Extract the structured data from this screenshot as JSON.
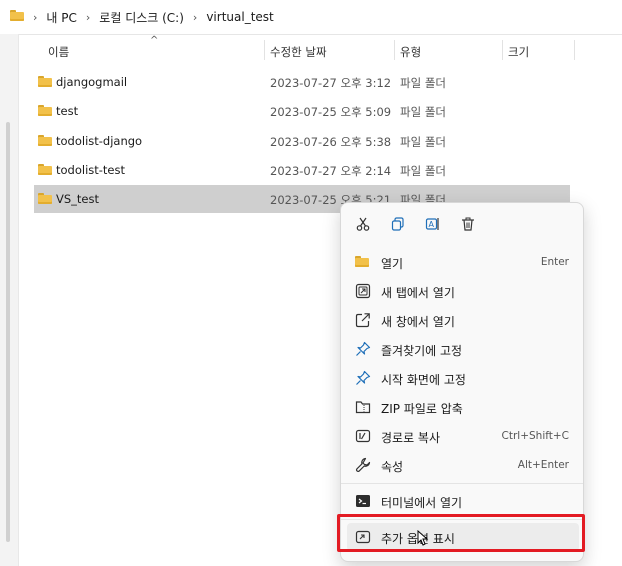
{
  "breadcrumb": [
    "내 PC",
    "로컬 디스크 (C:)",
    "virtual_test"
  ],
  "columns": {
    "name": "이름",
    "modified": "수정한 날짜",
    "type": "유형",
    "size": "크기"
  },
  "files": [
    {
      "name": "djangogmail",
      "date": "2023-07-27 오후 3:12",
      "type": "파일 폴더",
      "selected": false
    },
    {
      "name": "test",
      "date": "2023-07-25 오후 5:09",
      "type": "파일 폴더",
      "selected": false
    },
    {
      "name": "todolist-django",
      "date": "2023-07-26 오후 5:38",
      "type": "파일 폴더",
      "selected": false
    },
    {
      "name": "todolist-test",
      "date": "2023-07-27 오후 2:14",
      "type": "파일 폴더",
      "selected": false
    },
    {
      "name": "VS_test",
      "date": "2023-07-25 오후 5:21",
      "type": "파일 폴더",
      "selected": true
    }
  ],
  "context_menu": {
    "toolbar": [
      "cut-icon",
      "copy-icon",
      "rename-icon",
      "delete-icon"
    ],
    "items": [
      {
        "label": "열기",
        "shortcut": "Enter",
        "icon": "folder-icon"
      },
      {
        "label": "새 탭에서 열기",
        "shortcut": "",
        "icon": "new-tab-icon"
      },
      {
        "label": "새 창에서 열기",
        "shortcut": "",
        "icon": "new-window-icon"
      },
      {
        "label": "즐겨찾기에 고정",
        "shortcut": "",
        "icon": "pin-icon"
      },
      {
        "label": "시작 화면에 고정",
        "shortcut": "",
        "icon": "pin-icon"
      },
      {
        "label": "ZIP 파일로 압축",
        "shortcut": "",
        "icon": "zip-icon"
      },
      {
        "label": "경로로 복사",
        "shortcut": "Ctrl+Shift+C",
        "icon": "copy-path-icon"
      },
      {
        "label": "속성",
        "shortcut": "Alt+Enter",
        "icon": "wrench-icon"
      },
      {
        "label": "터미널에서 열기",
        "shortcut": "",
        "icon": "terminal-icon"
      },
      {
        "label": "추가 옵션 표시",
        "shortcut": "",
        "icon": "more-options-icon"
      }
    ]
  },
  "colors": {
    "highlight": "#e31b23",
    "selection": "#cfcfcf",
    "folder": "#f2c14a"
  }
}
